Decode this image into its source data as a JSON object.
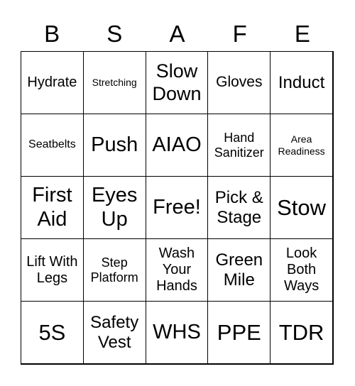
{
  "header": [
    "B",
    "S",
    "A",
    "F",
    "E"
  ],
  "cells": [
    [
      "Hydrate",
      "Stretching",
      "Slow Down",
      "Gloves",
      "Induct"
    ],
    [
      "Seatbelts",
      "Push",
      "AIAO",
      "Hand Sanitizer",
      "Area Readiness"
    ],
    [
      "First Aid",
      "Eyes Up",
      "Free!",
      "Pick & Stage",
      "Stow"
    ],
    [
      "Lift With Legs",
      "Step Platform",
      "Wash Your Hands",
      "Green Mile",
      "Look Both Ways"
    ],
    [
      "5S",
      "Safety Vest",
      "WHS",
      "PPE",
      "TDR"
    ]
  ]
}
